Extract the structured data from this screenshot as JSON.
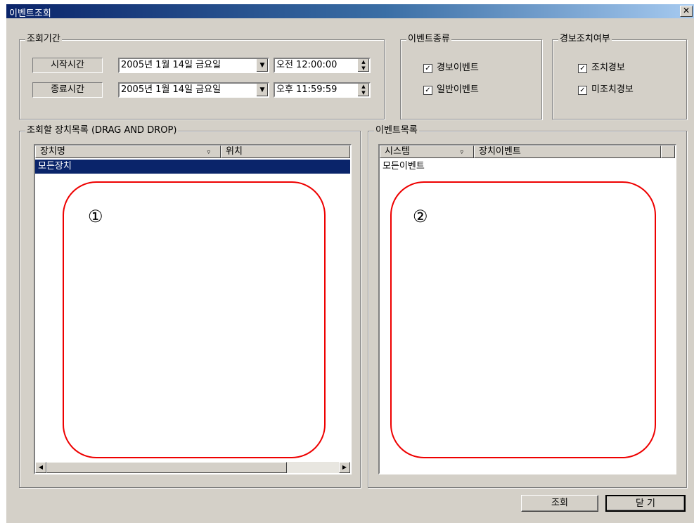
{
  "window": {
    "title": "이벤트조회",
    "close_glyph": "✕"
  },
  "period": {
    "legend": "조회기간",
    "start_label": "시작시간",
    "end_label": "종료시간",
    "start_date": "2005년  1월 14일 금요일",
    "start_time": "오전 12:00:00",
    "end_date": "2005년  1월 14일 금요일",
    "end_time": "오후 11:59:59"
  },
  "event_type": {
    "legend": "이벤트종류",
    "options": [
      {
        "label": "경보이벤트",
        "checked": true
      },
      {
        "label": "일반이벤트",
        "checked": true
      }
    ]
  },
  "alarm_action": {
    "legend": "경보조치여부",
    "options": [
      {
        "label": "조치경보",
        "checked": true
      },
      {
        "label": "미조치경보",
        "checked": true
      }
    ]
  },
  "device_list": {
    "legend": "조회할 장치목록 (DRAG AND DROP)",
    "columns": [
      "장치명",
      "위치"
    ],
    "rows": [
      "모든장치"
    ],
    "marker": "①"
  },
  "event_list": {
    "legend": "이벤트목록",
    "columns": [
      "시스템",
      "장치이벤트"
    ],
    "rows": [
      "모든이벤트"
    ],
    "marker": "②"
  },
  "buttons": {
    "query": "조회",
    "close": "닫 기"
  },
  "colors": {
    "selection": "#0a246a",
    "annotation": "#e00000",
    "face": "#d4d0c8"
  }
}
